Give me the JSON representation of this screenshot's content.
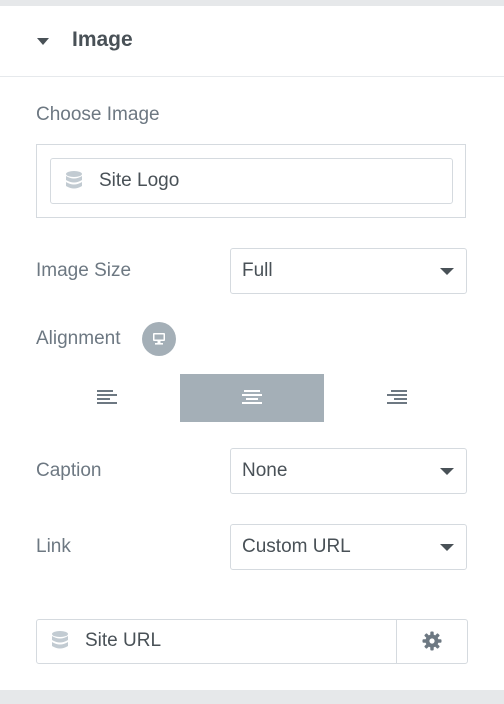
{
  "section": {
    "title": "Image"
  },
  "choose_image": {
    "label": "Choose Image",
    "dynamic_tag": "Site Logo"
  },
  "image_size": {
    "label": "Image Size",
    "value": "Full"
  },
  "alignment": {
    "label": "Alignment",
    "options": [
      "left",
      "center",
      "right"
    ],
    "selected": "center"
  },
  "caption": {
    "label": "Caption",
    "value": "None"
  },
  "link": {
    "label": "Link",
    "value": "Custom URL",
    "url_dynamic_tag": "Site URL"
  },
  "icons": {
    "section_toggle": "caret-down-icon",
    "dynamic": "database-icon",
    "responsive": "desktop-icon",
    "align_left": "align-left-icon",
    "align_center": "align-center-icon",
    "align_right": "align-right-icon",
    "settings": "gear-icon"
  },
  "colors": {
    "heading": "#495157",
    "label": "#6d7882",
    "border": "#d5dadf",
    "active_choice": "#a4afb7"
  }
}
